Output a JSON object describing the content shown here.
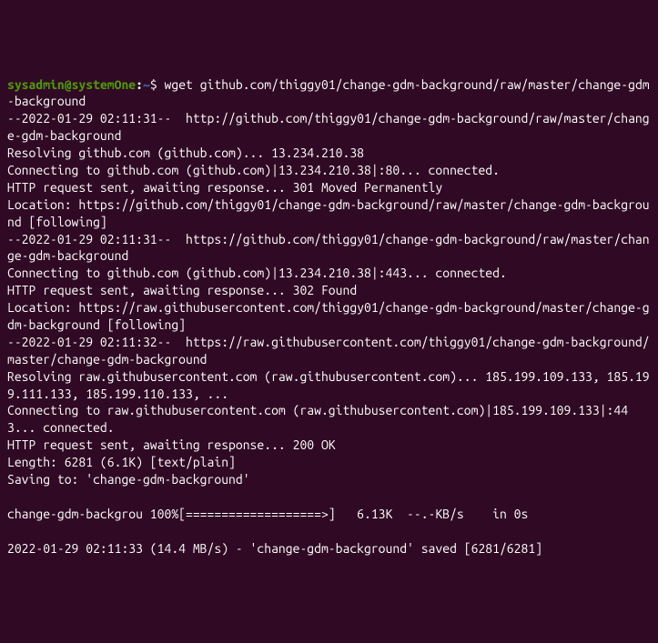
{
  "prompt": {
    "user": "sysadmin",
    "at": "@",
    "host": "systemOne",
    "colon": ":",
    "path": "~",
    "dollar": "$ "
  },
  "command": "wget github.com/thiggy01/change-gdm-background/raw/master/change-gdm-background",
  "output": {
    "l1": "--2022-01-29 02:11:31--  http://github.com/thiggy01/change-gdm-background/raw/master/change-gdm-background",
    "l2": "Resolving github.com (github.com)... 13.234.210.38",
    "l3": "Connecting to github.com (github.com)|13.234.210.38|:80... connected.",
    "l4": "HTTP request sent, awaiting response... 301 Moved Permanently",
    "l5": "Location: https://github.com/thiggy01/change-gdm-background/raw/master/change-gdm-background [following]",
    "l6": "--2022-01-29 02:11:31--  https://github.com/thiggy01/change-gdm-background/raw/master/change-gdm-background",
    "l7": "Connecting to github.com (github.com)|13.234.210.38|:443... connected.",
    "l8": "HTTP request sent, awaiting response... 302 Found",
    "l9": "Location: https://raw.githubusercontent.com/thiggy01/change-gdm-background/master/change-gdm-background [following]",
    "l10": "--2022-01-29 02:11:32--  https://raw.githubusercontent.com/thiggy01/change-gdm-background/master/change-gdm-background",
    "l11": "Resolving raw.githubusercontent.com (raw.githubusercontent.com)... 185.199.109.133, 185.199.111.133, 185.199.110.133, ...",
    "l12": "Connecting to raw.githubusercontent.com (raw.githubusercontent.com)|185.199.109.133|:443... connected.",
    "l13": "HTTP request sent, awaiting response... 200 OK",
    "l14": "Length: 6281 (6.1K) [text/plain]",
    "l15": "Saving to: 'change-gdm-background'",
    "blank1": "",
    "l16": "change-gdm-backgrou 100%[===================>]   6.13K  --.-KB/s    in 0s",
    "blank2": "",
    "l17": "2022-01-29 02:11:33 (14.4 MB/s) - 'change-gdm-background' saved [6281/6281]"
  }
}
